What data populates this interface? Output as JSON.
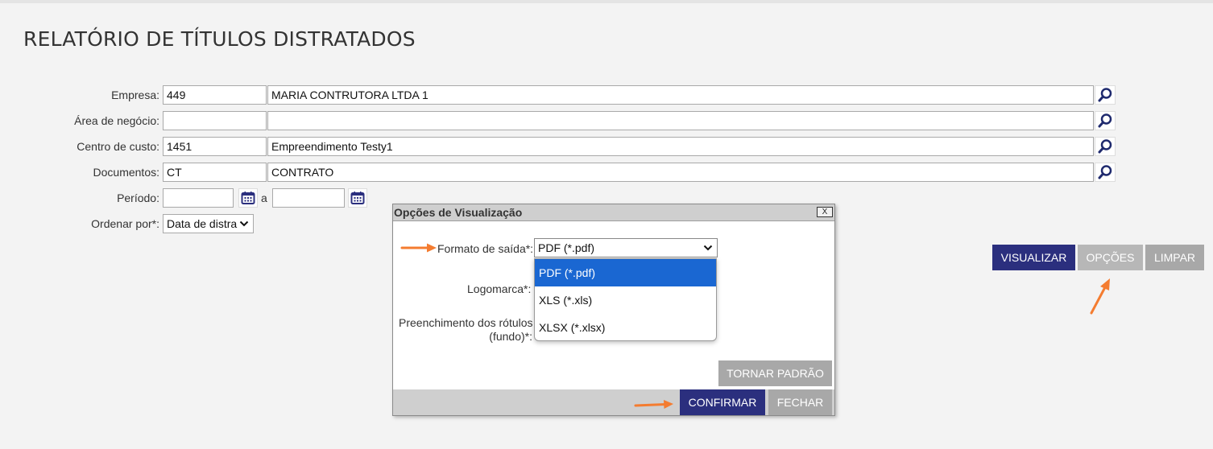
{
  "page": {
    "title": "RELATÓRIO DE TÍTULOS DISTRATADOS"
  },
  "form": {
    "empresa": {
      "label": "Empresa:",
      "code": "449",
      "name": "MARIA CONTRUTORA LTDA 1"
    },
    "area": {
      "label": "Área de negócio:",
      "code": "",
      "name": ""
    },
    "centro": {
      "label": "Centro de custo:",
      "code": "1451",
      "name": "Empreendimento Testy1"
    },
    "documentos": {
      "label": "Documentos:",
      "code": "CT",
      "name": "CONTRATO"
    },
    "periodo": {
      "label": "Período:",
      "start": "",
      "separator": "a",
      "end": ""
    },
    "ordenar": {
      "label": "Ordenar por*:",
      "value": "Data de distra"
    }
  },
  "actions": {
    "visualizar": "VISUALIZAR",
    "opcoes": "OPÇÕES",
    "limpar": "LIMPAR"
  },
  "modal": {
    "title": "Opções de Visualização",
    "close": "X",
    "formato_label": "Formato de saída*:",
    "formato_value": "PDF (*.pdf)",
    "logomarca_label": "Logomarca*:",
    "preenchimento_label_1": "Preenchimento dos rótulos",
    "preenchimento_label_2": "(fundo)*:",
    "options": [
      "PDF (*.pdf)",
      "XLS (*.xls)",
      "XLSX (*.xlsx)"
    ],
    "selected_option": 0,
    "tornar_padrao": "TORNAR PADRÃO",
    "confirmar": "CONFIRMAR",
    "fechar": "FECHAR"
  },
  "icons": {
    "lookup": "magnifier-icon",
    "calendar": "calendar-icon",
    "dropdown": "chevron-down-icon",
    "annotation": "orange-arrow"
  },
  "colors": {
    "primary": "#2b2f7e",
    "secondary": "#a8a8a8",
    "highlight": "#1a67d2",
    "annotation": "#f47c30",
    "lookup_icon": "#1f2a6e"
  }
}
